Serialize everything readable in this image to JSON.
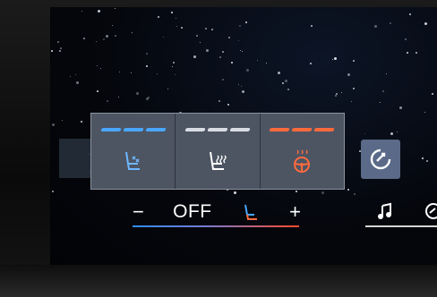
{
  "seat_panel": {
    "tiles": [
      {
        "name": "seat-ventilation-tile",
        "icon": "seat-ventilation-icon",
        "bar_color": "#4aa6ff"
      },
      {
        "name": "seat-heating-tile",
        "icon": "seat-heating-icon",
        "bar_color": "#d9dde3"
      },
      {
        "name": "steering-wheel-heating-tile",
        "icon": "steering-wheel-heating-icon",
        "bar_color": "#ff6a3d"
      }
    ]
  },
  "drive_mode": {
    "icon": "drive-mode-icon"
  },
  "climate_bar": {
    "minus": "−",
    "status": "OFF",
    "seat_icon": "seat-icon",
    "plus": "+"
  },
  "media": {
    "icon": "music-note-icon",
    "partial_icon": "navigation-icon"
  },
  "colors": {
    "accent_blue": "#2f8cff",
    "accent_red": "#ff4a2a",
    "panel": "#4d5563"
  }
}
